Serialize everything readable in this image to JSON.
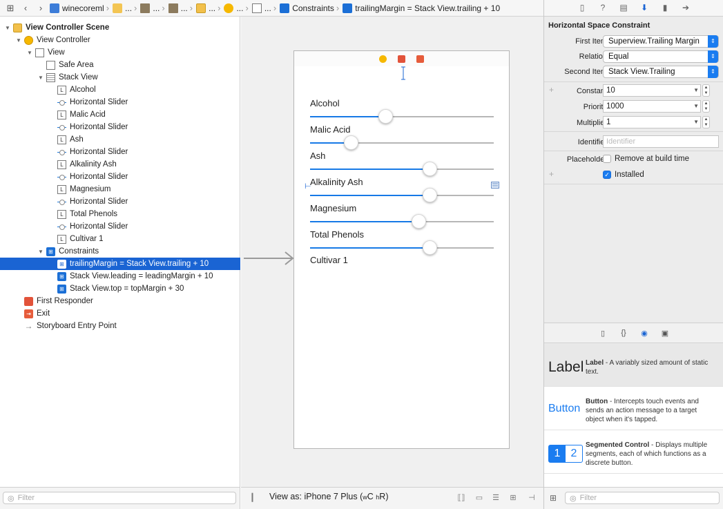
{
  "jumpbar": {
    "project": "winecoreml",
    "ellipsis": "...",
    "constraints": "Constraints",
    "selected": "trailingMargin = Stack View.trailing + 10"
  },
  "tree": [
    {
      "label": "View Controller Scene",
      "icon": "scene",
      "indent": 0,
      "expand": "open",
      "bold": true
    },
    {
      "label": "View Controller",
      "icon": "vc",
      "indent": 1,
      "expand": "open"
    },
    {
      "label": "View",
      "icon": "view",
      "indent": 2,
      "expand": "open"
    },
    {
      "label": "Safe Area",
      "icon": "safe",
      "indent": 3
    },
    {
      "label": "Stack View",
      "icon": "stack",
      "indent": 3,
      "expand": "open"
    },
    {
      "label": "Alcohol",
      "icon": "label",
      "indent": 4
    },
    {
      "label": "Horizontal Slider",
      "icon": "slider",
      "indent": 4
    },
    {
      "label": "Malic Acid",
      "icon": "label",
      "indent": 4
    },
    {
      "label": "Horizontal Slider",
      "icon": "slider",
      "indent": 4
    },
    {
      "label": "Ash",
      "icon": "label",
      "indent": 4
    },
    {
      "label": "Horizontal Slider",
      "icon": "slider",
      "indent": 4
    },
    {
      "label": "Alkalinity Ash",
      "icon": "label",
      "indent": 4
    },
    {
      "label": "Horizontal Slider",
      "icon": "slider",
      "indent": 4
    },
    {
      "label": "Magnesium",
      "icon": "label",
      "indent": 4
    },
    {
      "label": "Horizontal Slider",
      "icon": "slider",
      "indent": 4
    },
    {
      "label": "Total Phenols",
      "icon": "label",
      "indent": 4
    },
    {
      "label": "Horizontal Slider",
      "icon": "slider",
      "indent": 4
    },
    {
      "label": "Cultivar 1",
      "icon": "label",
      "indent": 4
    },
    {
      "label": "Constraints",
      "icon": "cons",
      "indent": 3,
      "expand": "open"
    },
    {
      "label": "trailingMargin = Stack View.trailing + 10",
      "icon": "cons",
      "indent": 4,
      "selected": true
    },
    {
      "label": "Stack View.leading = leadingMargin + 10",
      "icon": "cons",
      "indent": 4
    },
    {
      "label": "Stack View.top = topMargin + 30",
      "icon": "cons",
      "indent": 4
    },
    {
      "label": "First Responder",
      "icon": "fr",
      "indent": 1
    },
    {
      "label": "Exit",
      "icon": "exit",
      "indent": 1
    },
    {
      "label": "Storyboard Entry Point",
      "icon": "entry",
      "indent": 1
    }
  ],
  "nav_filter": {
    "placeholder": "Filter"
  },
  "canvas": {
    "parameters": [
      {
        "name": "Alcohol",
        "slider_value": 0.41
      },
      {
        "name": "Malic Acid",
        "slider_value": 0.22
      },
      {
        "name": "Ash",
        "slider_value": 0.65
      },
      {
        "name": "Alkalinity Ash",
        "slider_value": 0.65
      },
      {
        "name": "Magnesium",
        "slider_value": 0.59
      },
      {
        "name": "Total Phenols",
        "slider_value": 0.65
      }
    ],
    "result_label": "Cultivar 1",
    "view_as_prefix": "View as: iPhone 7 Plus (",
    "view_as_w": "w",
    "view_as_wv": "C",
    "view_as_h": "h",
    "view_as_hv": "R",
    "view_as_suffix": ")"
  },
  "inspector": {
    "title": "Horizontal Space Constraint",
    "first_item_label": "First Item",
    "first_item_value": "Superview.Trailing Margin",
    "relation_label": "Relation",
    "relation_value": "Equal",
    "second_item_label": "Second Item",
    "second_item_value": "Stack View.Trailing",
    "constant_label": "Constant",
    "constant_value": "10",
    "priority_label": "Priority",
    "priority_value": "1000",
    "multiplier_label": "Multiplier",
    "multiplier_value": "1",
    "identifier_label": "Identifier",
    "identifier_placeholder": "Identifier",
    "placeholder_label": "Placeholder",
    "remove_label": "Remove at build time",
    "remove_checked": false,
    "installed_label": "Installed",
    "installed_checked": true
  },
  "library": [
    {
      "preview": "Label",
      "title": "Label",
      "desc": " - A variably sized amount of static text."
    },
    {
      "preview": "Button",
      "title": "Button",
      "desc": " - Intercepts touch events and sends an action message to a target object when it's tapped."
    },
    {
      "preview_a": "1",
      "preview_b": "2",
      "title": "Segmented Control",
      "desc": " - Displays multiple segments, each of which functions as a discrete button."
    }
  ],
  "lib_filter": {
    "placeholder": "Filter"
  },
  "colors": {
    "accent": "#1a64d3",
    "slider_fill": "#1679e6",
    "popup_caret": "#1a7cf0"
  }
}
